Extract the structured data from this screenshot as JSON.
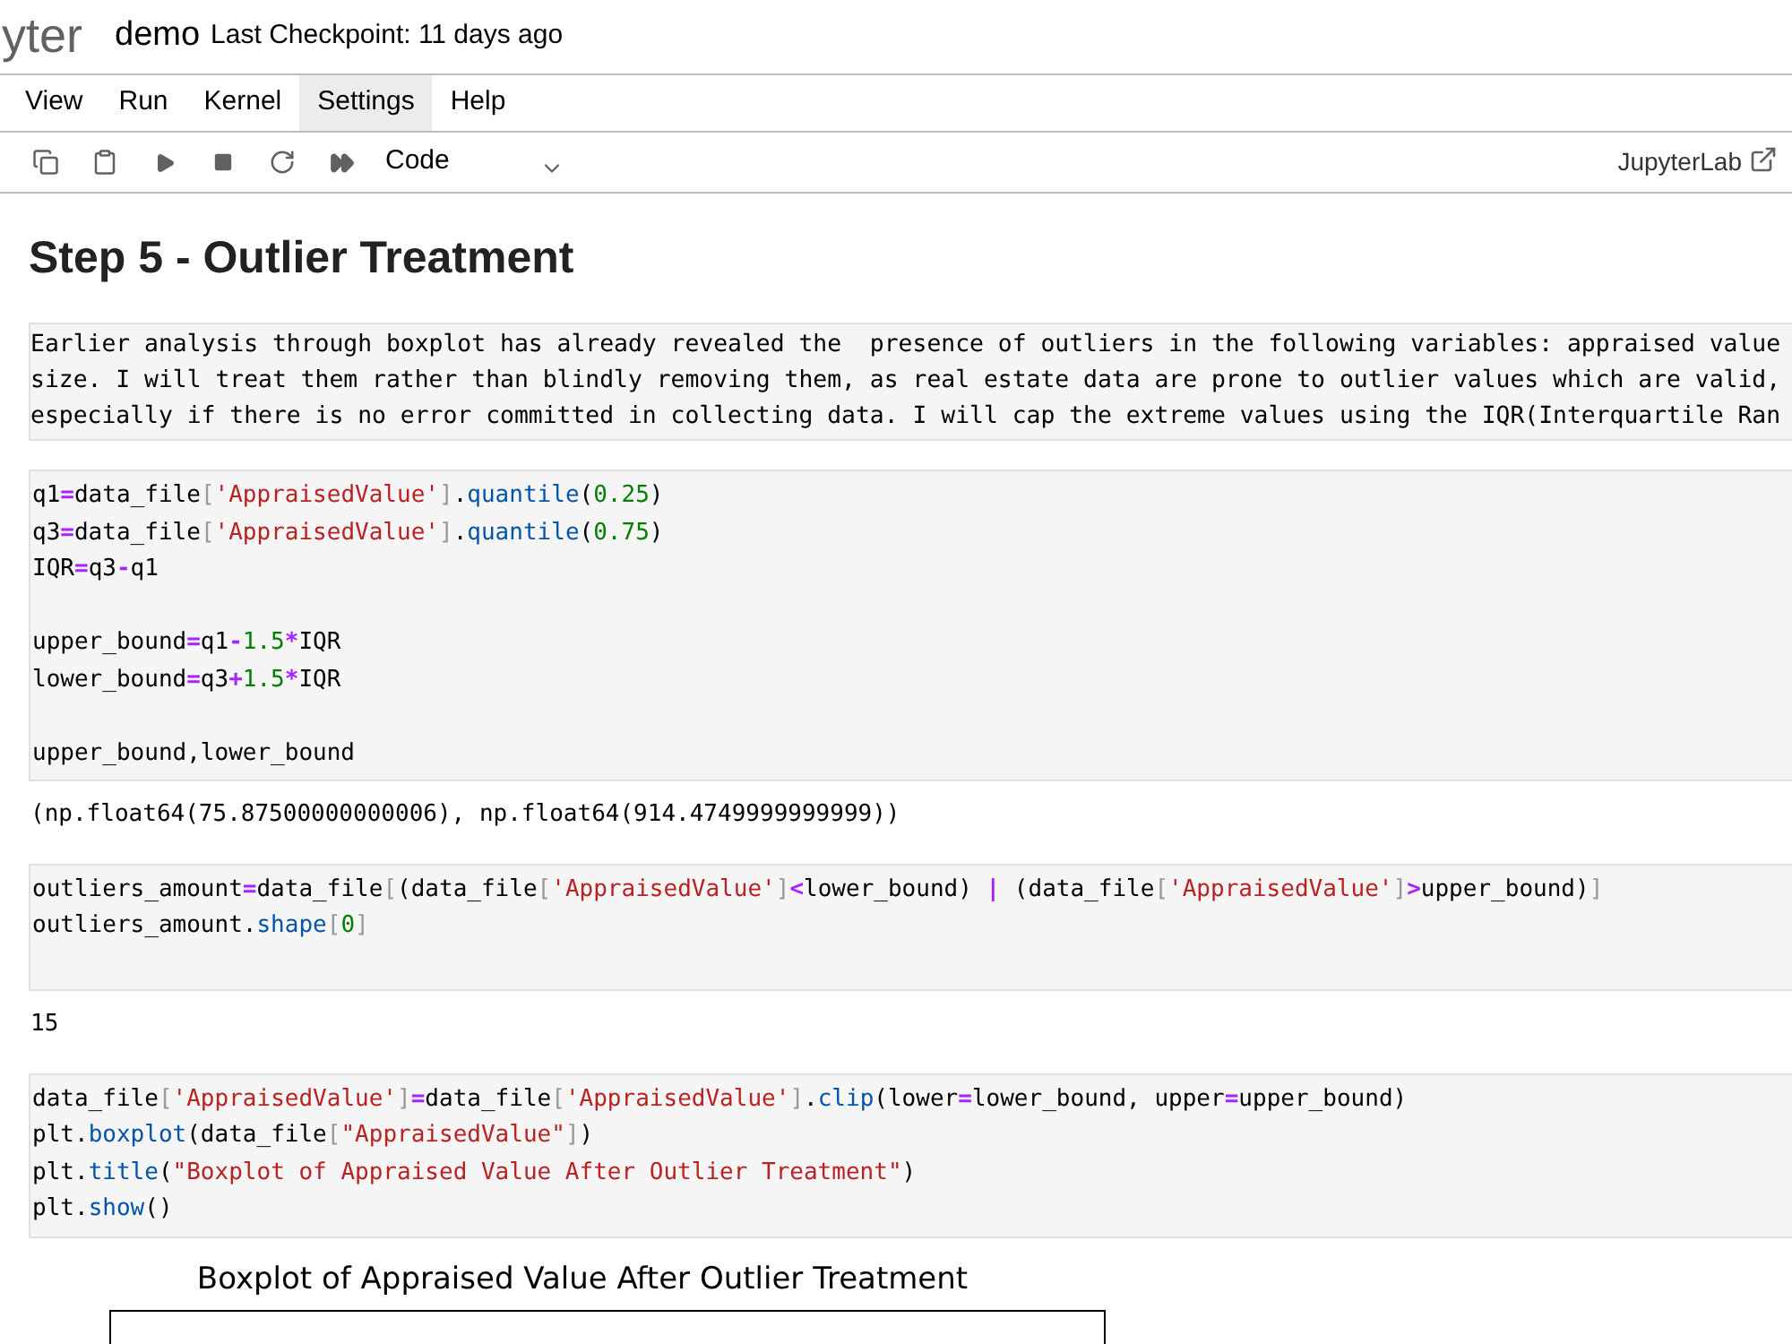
{
  "header": {
    "logo": "yter",
    "notebook_name": "demo",
    "checkpoint": "Last Checkpoint: 11 days ago"
  },
  "menu": [
    {
      "label": "View",
      "selected": false
    },
    {
      "label": "Run",
      "selected": false
    },
    {
      "label": "Kernel",
      "selected": false
    },
    {
      "label": "Settings",
      "selected": true
    },
    {
      "label": "Help",
      "selected": false
    }
  ],
  "toolbar": {
    "tools": [
      {
        "kind": "copy"
      },
      {
        "kind": "paste"
      },
      {
        "kind": "run"
      },
      {
        "kind": "stop"
      },
      {
        "kind": "restart"
      },
      {
        "kind": "run-all"
      }
    ],
    "cell_type": "Code",
    "link": "JupyterLab"
  },
  "cells": [
    {
      "kind": "heading",
      "text": "Step 5 - Outlier Treatment"
    },
    {
      "kind": "raw",
      "lines": [
        "Earlier analysis through boxplot has already revealed the  presence of outliers in the following variables: appraised value",
        "size. I will treat them rather than blindly removing them, as real estate data are prone to outlier values which are valid,",
        "especially if there is no error committed in collecting data. I will cap the extreme values using the IQR(Interquartile Ran"
      ]
    },
    {
      "kind": "code",
      "lines": [
        {
          "kind": "code",
          "tokens": [
            {
              "text": "q1",
              "kind": "plain"
            },
            {
              "text": "=",
              "kind": "op"
            },
            {
              "text": "data_file",
              "kind": "plain"
            },
            {
              "text": "[",
              "kind": "bracket"
            },
            {
              "text": "'AppraisedValue'",
              "kind": "string"
            },
            {
              "text": "]",
              "kind": "bracket"
            },
            {
              "text": ".",
              "kind": "plain"
            },
            {
              "text": "quantile",
              "kind": "func"
            },
            {
              "text": "(",
              "kind": "plain"
            },
            {
              "text": "0.25",
              "kind": "number"
            },
            {
              "text": ")",
              "kind": "plain"
            }
          ]
        },
        {
          "kind": "code",
          "tokens": [
            {
              "text": "q3",
              "kind": "plain"
            },
            {
              "text": "=",
              "kind": "op"
            },
            {
              "text": "data_file",
              "kind": "plain"
            },
            {
              "text": "[",
              "kind": "bracket"
            },
            {
              "text": "'AppraisedValue'",
              "kind": "string"
            },
            {
              "text": "]",
              "kind": "bracket"
            },
            {
              "text": ".",
              "kind": "plain"
            },
            {
              "text": "quantile",
              "kind": "func"
            },
            {
              "text": "(",
              "kind": "plain"
            },
            {
              "text": "0.75",
              "kind": "number"
            },
            {
              "text": ")",
              "kind": "plain"
            }
          ]
        },
        {
          "kind": "code",
          "tokens": [
            {
              "text": "IQR",
              "kind": "plain"
            },
            {
              "text": "=",
              "kind": "op"
            },
            {
              "text": "q3",
              "kind": "plain"
            },
            {
              "text": "-",
              "kind": "op"
            },
            {
              "text": "q1",
              "kind": "plain"
            }
          ]
        },
        {
          "kind": "blank"
        },
        {
          "kind": "code",
          "tokens": [
            {
              "text": "upper_bound",
              "kind": "plain"
            },
            {
              "text": "=",
              "kind": "op"
            },
            {
              "text": "q1",
              "kind": "plain"
            },
            {
              "text": "-",
              "kind": "op"
            },
            {
              "text": "1.5",
              "kind": "number"
            },
            {
              "text": "*",
              "kind": "op"
            },
            {
              "text": "IQR",
              "kind": "plain"
            }
          ]
        },
        {
          "kind": "code",
          "tokens": [
            {
              "text": "lower_bound",
              "kind": "plain"
            },
            {
              "text": "=",
              "kind": "op"
            },
            {
              "text": "q3",
              "kind": "plain"
            },
            {
              "text": "+",
              "kind": "op"
            },
            {
              "text": "1.5",
              "kind": "number"
            },
            {
              "text": "*",
              "kind": "op"
            },
            {
              "text": "IQR",
              "kind": "plain"
            }
          ]
        },
        {
          "kind": "blank"
        },
        {
          "kind": "code",
          "tokens": [
            {
              "text": "upper_bound,lower_bound",
              "kind": "plain"
            }
          ]
        }
      ]
    },
    {
      "kind": "output",
      "text": "(np.float64(75.87500000000006), np.float64(914.4749999999999))"
    },
    {
      "kind": "code",
      "lines": [
        {
          "kind": "code",
          "tokens": [
            {
              "text": "outliers_amount",
              "kind": "plain"
            },
            {
              "text": "=",
              "kind": "op"
            },
            {
              "text": "data_file",
              "kind": "plain"
            },
            {
              "text": "[",
              "kind": "bracket"
            },
            {
              "text": "(data_file",
              "kind": "plain"
            },
            {
              "text": "[",
              "kind": "bracket"
            },
            {
              "text": "'AppraisedValue'",
              "kind": "string"
            },
            {
              "text": "]",
              "kind": "bracket"
            },
            {
              "text": "<",
              "kind": "op"
            },
            {
              "text": "lower_bound) ",
              "kind": "plain"
            },
            {
              "text": "|",
              "kind": "op"
            },
            {
              "text": " (data_file",
              "kind": "plain"
            },
            {
              "text": "[",
              "kind": "bracket"
            },
            {
              "text": "'AppraisedValue'",
              "kind": "string"
            },
            {
              "text": "]",
              "kind": "bracket"
            },
            {
              "text": ">",
              "kind": "op"
            },
            {
              "text": "upper_bound)",
              "kind": "plain"
            },
            {
              "text": "]",
              "kind": "bracket"
            }
          ]
        },
        {
          "kind": "code",
          "tokens": [
            {
              "text": "outliers_amount.",
              "kind": "plain"
            },
            {
              "text": "shape",
              "kind": "func"
            },
            {
              "text": "[",
              "kind": "bracket"
            },
            {
              "text": "0",
              "kind": "number"
            },
            {
              "text": "]",
              "kind": "bracket"
            }
          ]
        },
        {
          "kind": "blank"
        }
      ]
    },
    {
      "kind": "output",
      "text": "15"
    },
    {
      "kind": "code",
      "lines": [
        {
          "kind": "code",
          "tokens": [
            {
              "text": "data_file",
              "kind": "plain"
            },
            {
              "text": "[",
              "kind": "bracket"
            },
            {
              "text": "'AppraisedValue'",
              "kind": "string"
            },
            {
              "text": "]",
              "kind": "bracket"
            },
            {
              "text": "=",
              "kind": "op"
            },
            {
              "text": "data_file",
              "kind": "plain"
            },
            {
              "text": "[",
              "kind": "bracket"
            },
            {
              "text": "'AppraisedValue'",
              "kind": "string"
            },
            {
              "text": "]",
              "kind": "bracket"
            },
            {
              "text": ".",
              "kind": "plain"
            },
            {
              "text": "clip",
              "kind": "func"
            },
            {
              "text": "(lower",
              "kind": "plain"
            },
            {
              "text": "=",
              "kind": "op"
            },
            {
              "text": "lower_bound, upper",
              "kind": "plain"
            },
            {
              "text": "=",
              "kind": "op"
            },
            {
              "text": "upper_bound)",
              "kind": "plain"
            }
          ]
        },
        {
          "kind": "code",
          "tokens": [
            {
              "text": "plt.",
              "kind": "plain"
            },
            {
              "text": "boxplot",
              "kind": "func"
            },
            {
              "text": "(data_file",
              "kind": "plain"
            },
            {
              "text": "[",
              "kind": "bracket"
            },
            {
              "text": "\"AppraisedValue\"",
              "kind": "string"
            },
            {
              "text": "]",
              "kind": "bracket"
            },
            {
              "text": ")",
              "kind": "plain"
            }
          ]
        },
        {
          "kind": "code",
          "tokens": [
            {
              "text": "plt.",
              "kind": "plain"
            },
            {
              "text": "title",
              "kind": "func"
            },
            {
              "text": "(",
              "kind": "plain"
            },
            {
              "text": "\"Boxplot of Appraised Value After Outlier Treatment\"",
              "kind": "string"
            },
            {
              "text": ")",
              "kind": "plain"
            }
          ]
        },
        {
          "kind": "code",
          "tokens": [
            {
              "text": "plt.",
              "kind": "plain"
            },
            {
              "text": "show",
              "kind": "func"
            },
            {
              "text": "()",
              "kind": "plain"
            }
          ]
        }
      ]
    },
    {
      "kind": "plot",
      "title": "Boxplot of Appraised Value After Outlier Treatment"
    }
  ]
}
